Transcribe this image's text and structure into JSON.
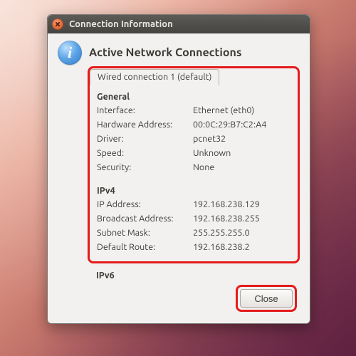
{
  "window": {
    "title": "Connection Information",
    "dialog_title": "Active Network Connections",
    "info_glyph": "i"
  },
  "tab": {
    "label": "Wired connection 1 (default)"
  },
  "general": {
    "heading": "General",
    "interface_label": "Interface:",
    "interface_value": "Ethernet (eth0)",
    "hwaddr_label": "Hardware Address:",
    "hwaddr_value": "00:0C:29:B7:C2:A4",
    "driver_label": "Driver:",
    "driver_value": "pcnet32",
    "speed_label": "Speed:",
    "speed_value": "Unknown",
    "security_label": "Security:",
    "security_value": "None"
  },
  "ipv4": {
    "heading": "IPv4",
    "ip_label": "IP Address:",
    "ip_value": "192.168.238.129",
    "bcast_label": "Broadcast Address:",
    "bcast_value": "192.168.238.255",
    "mask_label": "Subnet Mask:",
    "mask_value": "255.255.255.0",
    "route_label": "Default Route:",
    "route_value": "192.168.238.2"
  },
  "ipv6": {
    "heading": "IPv6"
  },
  "buttons": {
    "close": "Close"
  }
}
